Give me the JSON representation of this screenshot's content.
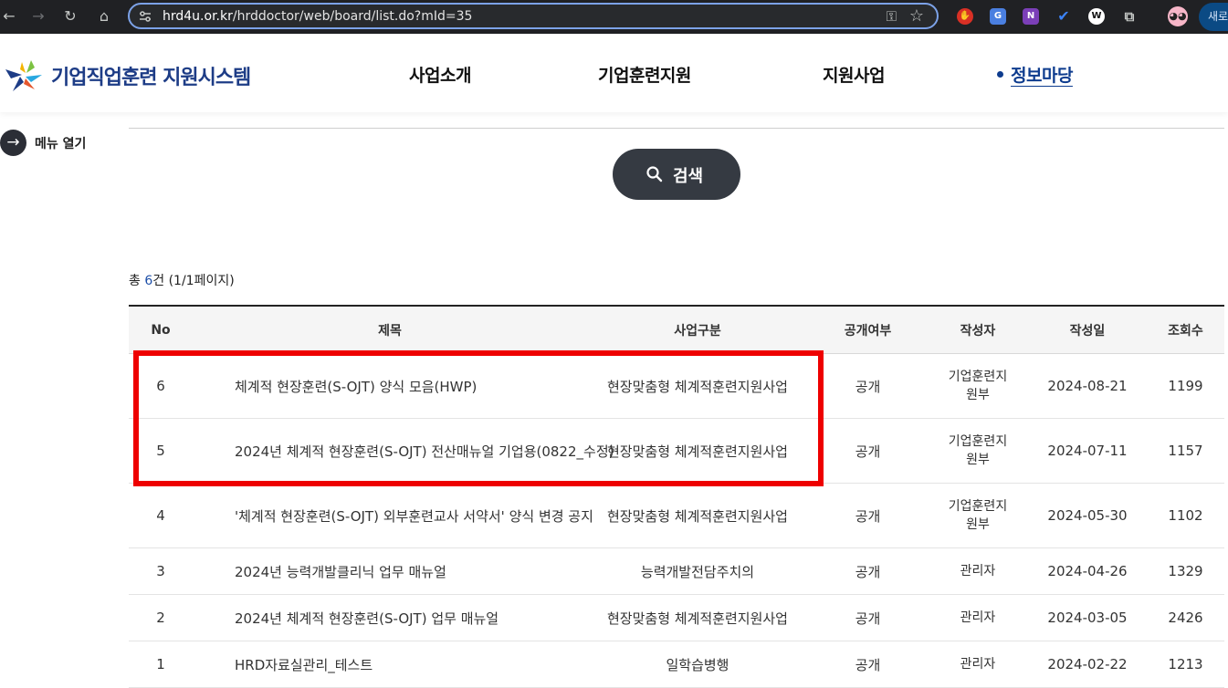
{
  "browser": {
    "url_host": "hrd4u.or.kr",
    "url_path": "/hrddoctor/web/board/list.do?mId=35",
    "new_tab_label": "새로"
  },
  "site": {
    "logo_text": "기업직업훈련 지원시스템",
    "nav": [
      "사업소개",
      "기업훈련지원",
      "지원사업",
      "정보마당"
    ],
    "menu_open_label": "메뉴 열기"
  },
  "search": {
    "button_label": "검색"
  },
  "summary": {
    "prefix": "총 ",
    "count": "6",
    "suffix": "건 (1/1페이지)"
  },
  "table": {
    "headers": [
      "No",
      "제목",
      "사업구분",
      "공개여부",
      "작성자",
      "작성일",
      "조회수"
    ],
    "rows": [
      {
        "no": "6",
        "title": "체계적 현장훈련(S-OJT) 양식 모음(HWP)",
        "biz": "현장맞춤형 체계적훈련지원사업",
        "open": "공개",
        "writer_line1": "기업훈련지",
        "writer_line2": "원부",
        "date": "2024-08-21",
        "views": "1199"
      },
      {
        "no": "5",
        "title": "2024년 체계적 현장훈련(S-OJT) 전산매뉴얼 기업용(0822_수정)",
        "biz": "현장맞춤형 체계적훈련지원사업",
        "open": "공개",
        "writer_line1": "기업훈련지",
        "writer_line2": "원부",
        "date": "2024-07-11",
        "views": "1157"
      },
      {
        "no": "4",
        "title": "'체계적 현장훈련(S-OJT) 외부훈련교사 서약서' 양식 변경 공지",
        "biz": "현장맞춤형 체계적훈련지원사업",
        "open": "공개",
        "writer_line1": "기업훈련지",
        "writer_line2": "원부",
        "date": "2024-05-30",
        "views": "1102"
      },
      {
        "no": "3",
        "title": "2024년 능력개발클리닉 업무 매뉴얼",
        "biz": "능력개발전담주치의",
        "open": "공개",
        "writer_line1": "관리자",
        "writer_line2": "",
        "date": "2024-04-26",
        "views": "1329"
      },
      {
        "no": "2",
        "title": "2024년 체계적 현장훈련(S-OJT) 업무 매뉴얼",
        "biz": "현장맞춤형 체계적훈련지원사업",
        "open": "공개",
        "writer_line1": "관리자",
        "writer_line2": "",
        "date": "2024-03-05",
        "views": "2426"
      },
      {
        "no": "1",
        "title": "HRD자료실관리_테스트",
        "biz": "일학습병행",
        "open": "공개",
        "writer_line1": "관리자",
        "writer_line2": "",
        "date": "2024-02-22",
        "views": "1213"
      }
    ]
  },
  "colors": {
    "highlight": "#ee0000",
    "brand": "#1d3c86",
    "search_button": "#353a42"
  }
}
